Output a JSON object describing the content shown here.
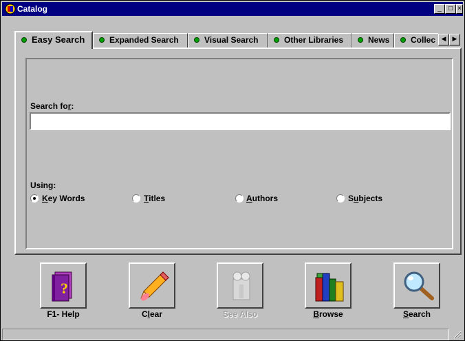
{
  "window": {
    "title": "Catalog"
  },
  "titlebar": {
    "minimize": "_",
    "maximize": "□",
    "close": "×"
  },
  "tabs": [
    {
      "label": "Easy Search",
      "active": true
    },
    {
      "label": "Expanded Search",
      "active": false
    },
    {
      "label": "Visual Search",
      "active": false
    },
    {
      "label": "Other Libraries",
      "active": false
    },
    {
      "label": "News",
      "active": false
    },
    {
      "label": "Collec",
      "active": false
    }
  ],
  "tab_scroll": {
    "left": "◀",
    "right": "▶"
  },
  "search": {
    "label_prefix": "Search fo",
    "label_hotkey": "r",
    "label_suffix": ":",
    "value": "",
    "using_label": "Using:"
  },
  "using_options": [
    {
      "hotkey": "K",
      "rest": "ey Words",
      "selected": true
    },
    {
      "hotkey": "T",
      "rest": "itles",
      "selected": false
    },
    {
      "hotkey": "A",
      "rest": "uthors",
      "selected": false
    },
    {
      "prefix": "S",
      "hotkey": "u",
      "rest": "bjects",
      "selected": false
    }
  ],
  "toolbar": {
    "help": {
      "label": "F1- Help",
      "icon": "help-book-icon"
    },
    "clear": {
      "prefix": "C",
      "hotkey": "l",
      "rest": "ear",
      "icon": "pencil-eraser-icon"
    },
    "see_also": {
      "label": "See Also",
      "icon": "see-also-icon",
      "enabled": false
    },
    "browse": {
      "hotkey": "B",
      "rest": "rowse",
      "icon": "books-icon"
    },
    "search": {
      "hotkey": "S",
      "rest": "earch",
      "icon": "magnifier-icon"
    }
  },
  "statusbar": {
    "text": ""
  }
}
